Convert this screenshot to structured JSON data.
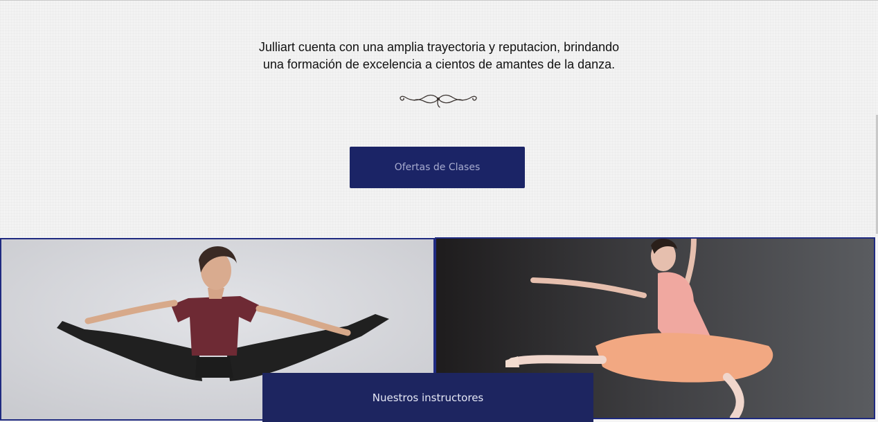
{
  "intro": {
    "line1": "Julliart cuenta con una amplia trayectoria y reputacion, brindando",
    "line2": "una formación de excelencia a cientos de amantes de la danza."
  },
  "ornament_icon": "flourish-divider-icon",
  "buttons": {
    "clases_label": "Ofertas de Clases",
    "instructores_label": "Nuestros instructores"
  },
  "photos": {
    "left": "male-dancer-split-leap-photo",
    "right": "ballerina-tutu-photo"
  },
  "colors": {
    "button_navy": "#1b2466",
    "border_blue": "#1f2a80",
    "background": "#f3f3f3"
  }
}
